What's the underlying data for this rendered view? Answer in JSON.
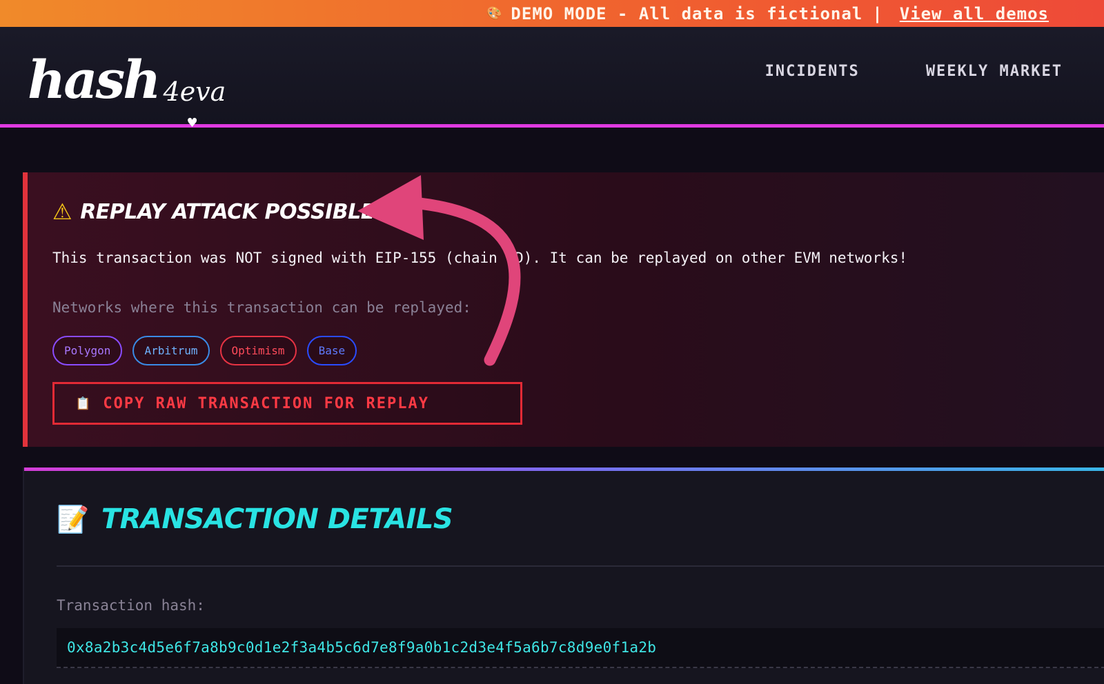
{
  "banner": {
    "icon": "palette-icon",
    "text": "DEMO MODE - All data is fictional",
    "separator": "|",
    "link": "View all demos"
  },
  "header": {
    "logo_main": "hash",
    "logo_sub": "4eva",
    "nav": [
      {
        "label": "INCIDENTS"
      },
      {
        "label": "WEEKLY MARKET"
      }
    ]
  },
  "alert": {
    "icon": "warning-icon",
    "title": "REPLAY ATTACK POSSIBLE",
    "message": "This transaction was NOT signed with EIP-155 (chain ID). It can be replayed on other EVM networks!",
    "subtitle": "Networks where this transaction can be replayed:",
    "networks": [
      {
        "label": "Polygon"
      },
      {
        "label": "Arbitrum"
      },
      {
        "label": "Optimism"
      },
      {
        "label": "Base"
      }
    ],
    "copy_button_icon": "clipboard-icon",
    "copy_button_label": "COPY RAW TRANSACTION FOR REPLAY"
  },
  "details": {
    "icon": "memo-icon",
    "title": "TRANSACTION DETAILS",
    "hash_label": "Transaction hash:",
    "hash_value": "0x8a2b3c4d5e6f7a8b9c0d1e2f3a4b5c6d7e8f9a0b1c2d3e4f5a6b7c8d9e0f1a2b"
  },
  "colors": {
    "accent_magenta": "#e03ae0",
    "alert_red": "#e2333c",
    "cyan": "#29e3e3",
    "annotation_pink": "#e0457a"
  }
}
